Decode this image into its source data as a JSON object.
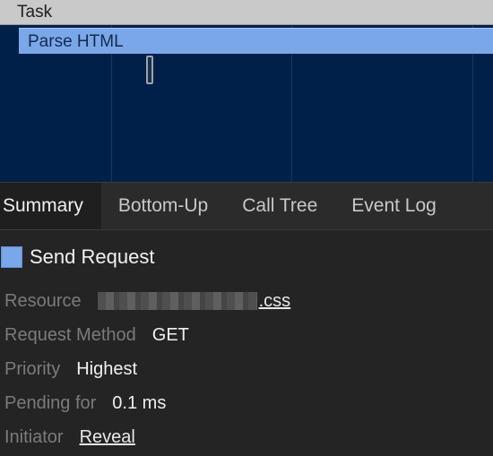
{
  "flame_chart": {
    "task_label": "Task",
    "parse_label": "Parse HTML"
  },
  "tabs": [
    {
      "label": "Summary",
      "active": true
    },
    {
      "label": "Bottom-Up",
      "active": false
    },
    {
      "label": "Call Tree",
      "active": false
    },
    {
      "label": "Event Log",
      "active": false
    }
  ],
  "summary": {
    "title": "Send Request",
    "swatch_color": "#7aa7e8",
    "rows": {
      "resource": {
        "label": "Resource",
        "value": ".css"
      },
      "request_method": {
        "label": "Request Method",
        "value": "GET"
      },
      "priority": {
        "label": "Priority",
        "value": "Highest"
      },
      "pending_for": {
        "label": "Pending for",
        "value": "0.1 ms"
      },
      "initiator": {
        "label": "Initiator",
        "value": "Reveal"
      }
    }
  }
}
